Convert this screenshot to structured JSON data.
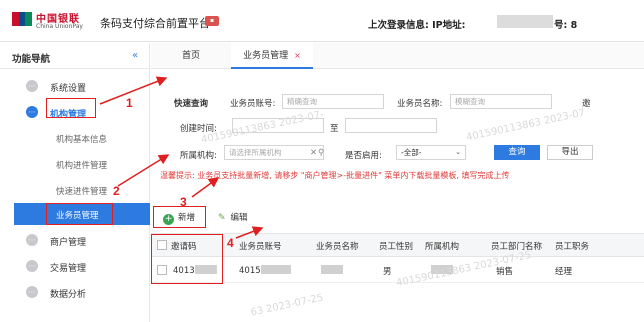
{
  "header": {
    "logo_cn": "中国银联",
    "logo_en": "China UnionPay",
    "system_title": "条码支付综合前置平台",
    "login_info": "上次登录信息:  IP地址:",
    "login_tail": "号: 8",
    "colors": {
      "brand_red": "#c8102e",
      "accent_blue": "#2d7be0"
    }
  },
  "sidebar": {
    "title": "功能导航",
    "collapse_icon": "«",
    "items": [
      {
        "label": "系统设置",
        "icon": "gear-circle-icon"
      },
      {
        "label": "机构管理",
        "icon": "org-circle-icon"
      },
      {
        "label": "机构基本信息"
      },
      {
        "label": "机构进件管理"
      },
      {
        "label": "快速进件管理"
      },
      {
        "label": "业务员管理"
      },
      {
        "label": "商户管理",
        "icon": "merchant-circle-icon"
      },
      {
        "label": "交易管理",
        "icon": "trade-circle-icon"
      },
      {
        "label": "数据分析",
        "icon": "analysis-circle-icon"
      }
    ]
  },
  "tabs": {
    "home": "首页",
    "active": "业务员管理",
    "close": "×"
  },
  "query": {
    "title": "快速查询",
    "account_label": "业务员账号:",
    "account_placeholder": "精确查询",
    "name_label": "业务员名称:",
    "name_placeholder": "模糊查询",
    "more": "邀",
    "created_label": "创建时间:",
    "to_label": "至",
    "org_label": "所属机构:",
    "org_placeholder": "请选择所属机构",
    "enabled_label": "是否启用:",
    "enabled_value": "-全部-",
    "query_button": "查询",
    "export_button": "导出"
  },
  "tip": "温馨提示: 业务员支持批量新增, 请移步 \"商户管理>-批量进件\" 菜单内下载批量模板, 填写完成上传",
  "toolbar": {
    "add": "新增",
    "edit": "编辑"
  },
  "table": {
    "columns": [
      "邀请码",
      "业务员账号",
      "业务员名称",
      "员工性别",
      "所属机构",
      "员工部门名称",
      "员工职务"
    ],
    "rows": [
      {
        "invite_code": "4013",
        "account": "4015",
        "name": "",
        "gender": "男",
        "org": "",
        "dept": "销售",
        "title": "经理"
      }
    ]
  },
  "annotations": {
    "n1": "1",
    "n2": "2",
    "n3": "3",
    "n4": "4"
  },
  "watermarks": [
    "401590113863 2023-07-",
    "401590113863 2023-07",
    "401590113863 2023-07-25",
    "63 2023-07-25"
  ]
}
